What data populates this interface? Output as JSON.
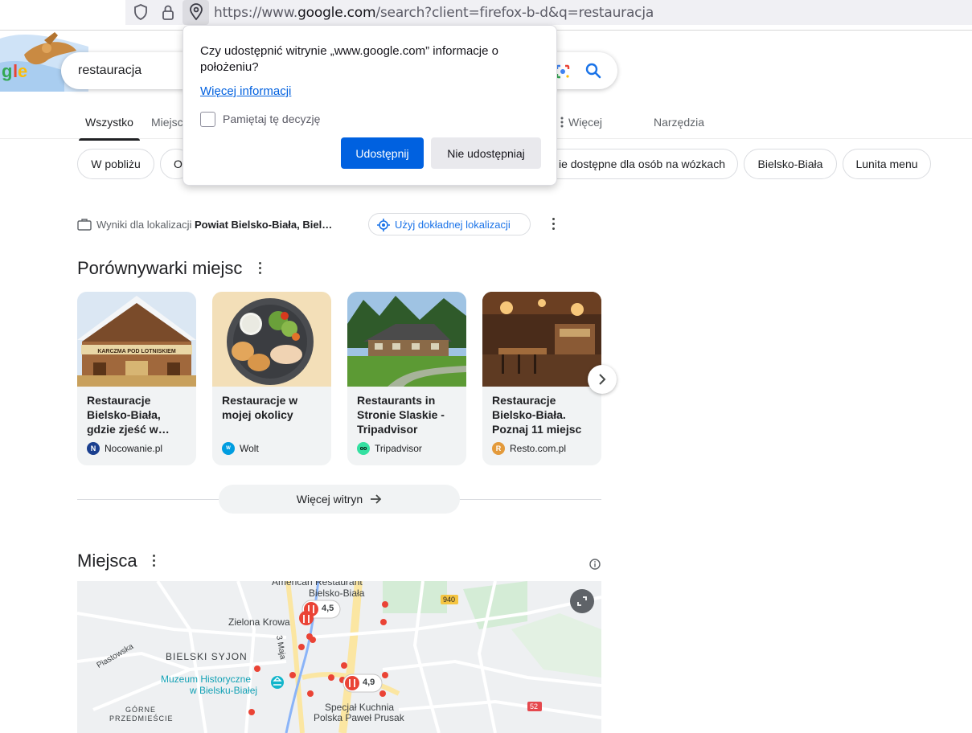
{
  "browser": {
    "url_prefix": "https://www.",
    "url_domain": "google.com",
    "url_suffix": "/search?client=firefox-b-d&q=restauracja"
  },
  "search": {
    "query": "restauracja"
  },
  "tabs": [
    "Wszystko",
    "Miejsc",
    "Więcej",
    "Narzędzia"
  ],
  "chips": [
    "W pobliżu",
    "O",
    "ie dostępne dla osób na wózkach",
    "Bielsko-Biała",
    "Lunita menu"
  ],
  "location": {
    "prefix": "Wyniki dla lokalizacji",
    "place": "Powiat Bielsko-Biała, Biel…",
    "precise_button": "Użyj dokładnej lokalizacji"
  },
  "comparisons": {
    "heading": "Porównywarki miejsc",
    "cards": [
      {
        "title": "Restauracje Bielsko-Biała, gdzie zjeść w…",
        "source": "Nocowanie.pl",
        "fav_text": "N",
        "fav_color": "#1a3f8f"
      },
      {
        "title": "Restauracje w mojej okolicy",
        "source": "Wolt",
        "fav_text": "W",
        "fav_color": "#009de0"
      },
      {
        "title": "Restaurants in Stronie Slaskie - Tripadvisor",
        "source": "Tripadvisor",
        "fav_text": "oo",
        "fav_color": "#34e0a1"
      },
      {
        "title": "Restauracje Bielsko-Biała. Poznaj 11 miejsc",
        "source": "Resto.com.pl",
        "fav_text": "R",
        "fav_color": "#e39a3b"
      }
    ],
    "more_sites": "Więcej witryn"
  },
  "places": {
    "heading": "Miejsca",
    "map_labels": {
      "american": "American Restaurant",
      "bielsko_biala": "Bielsko-Biała",
      "zielona_krowa": "Zielona Krowa",
      "piastowska": "Piastowska",
      "bielski_syjon": "BIELSKI SYJON",
      "trzeciego_maja": "3 Maja",
      "muzeum_1": "Muzeum Historyczne",
      "muzeum_2": "w Bielsku-Białej",
      "gorne_1": "GÓRNE",
      "gorne_2": "PRZEDMIEŚCIE",
      "specjal_1": "Specjał Kuchnia",
      "specjal_2": "Polska Paweł Prusak",
      "road_940": "940",
      "road_52": "52",
      "rating_1": "4,5",
      "rating_2": "4,9"
    }
  },
  "permission": {
    "message": "Czy udostępnić witrynie „www.google.com” informacje o położeniu?",
    "more_info": "Więcej informacji",
    "remember": "Pamiętaj tę decyzję",
    "allow": "Udostępnij",
    "deny": "Nie udostępniaj"
  },
  "colors": {
    "accent": "#1a73e8",
    "firefox_blue": "#0061e0",
    "map_pin": "#ea4335"
  }
}
